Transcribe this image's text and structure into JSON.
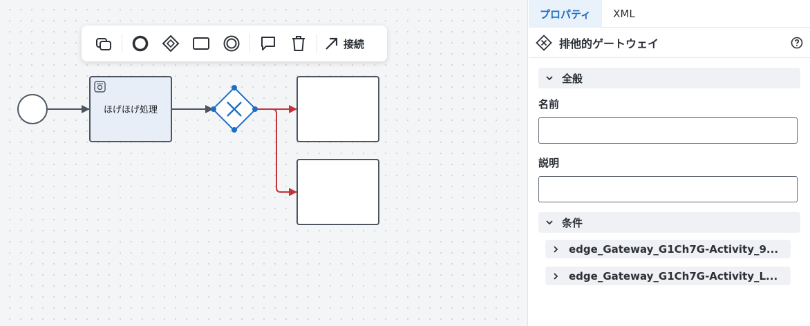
{
  "canvas": {
    "task_label": "ほげほげ処理"
  },
  "toolbar": {
    "connect_label": "接続",
    "icons": [
      "subprocess-icon",
      "end-event-icon",
      "gateway-icon",
      "task-icon",
      "intermediate-event-icon",
      "comment-icon",
      "trash-icon",
      "connect-arrow-icon"
    ]
  },
  "panel": {
    "tabs": [
      {
        "label": "プロパティ"
      },
      {
        "label": "XML"
      }
    ],
    "element_title": "排他的ゲートウェイ",
    "general": {
      "title": "全般",
      "name_label": "名前",
      "name_value": "",
      "desc_label": "説明",
      "desc_value": ""
    },
    "conditions": {
      "title": "条件",
      "items": [
        {
          "label": "edge_Gateway_G1Ch7G-Activity_9..."
        },
        {
          "label": "edge_Gateway_G1Ch7G-Activity_L..."
        }
      ]
    }
  },
  "colors": {
    "accent": "#1f6fc5",
    "selected_flow": "#c0353a",
    "task_fill": "#e8eef7",
    "stroke": "#4d5561"
  }
}
